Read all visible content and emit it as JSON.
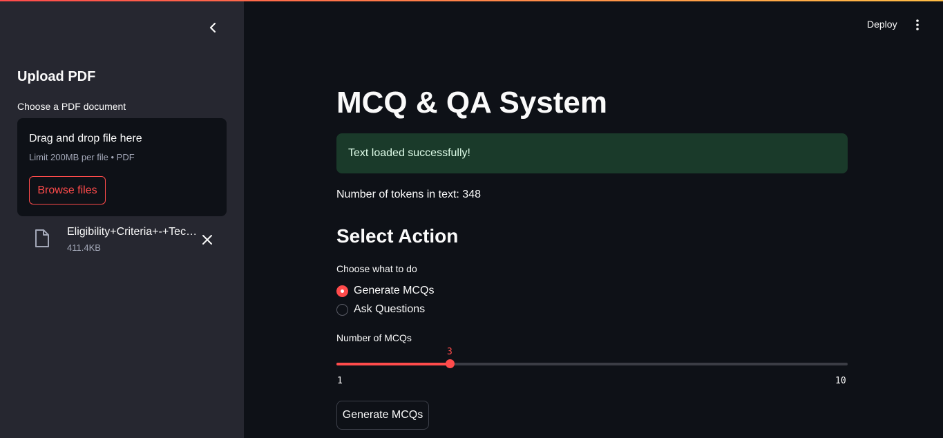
{
  "colors": {
    "accent": "#ff4b4b",
    "sidebar_bg": "#262730",
    "main_bg": "#0e1117",
    "success_bg": "#1a3a2a"
  },
  "sidebar": {
    "collapse_icon": "chevron-left-icon",
    "heading": "Upload PDF",
    "uploader_label": "Choose a PDF document",
    "dropzone": {
      "title": "Drag and drop file here",
      "limit": "Limit 200MB per file • PDF",
      "browse_label": "Browse files"
    },
    "file": {
      "icon": "file-icon",
      "name": "Eligibility+Criteria+-+Technical.pdf",
      "size": "411.4KB",
      "remove_icon": "close-icon"
    }
  },
  "header": {
    "deploy_label": "Deploy",
    "menu_icon": "kebab-menu-icon"
  },
  "main": {
    "title": "MCQ & QA System",
    "success_message": "Text loaded successfully!",
    "tokens_text": "Number of tokens in text: 348",
    "section_heading": "Select Action",
    "radio": {
      "label": "Choose what to do",
      "options": [
        {
          "label": "Generate MCQs",
          "selected": true
        },
        {
          "label": "Ask Questions",
          "selected": false
        }
      ]
    },
    "slider": {
      "label": "Number of MCQs",
      "value": 3,
      "value_text": "3",
      "min": 1,
      "max": 10,
      "min_text": "1",
      "max_text": "10"
    },
    "generate_button": "Generate MCQs"
  }
}
